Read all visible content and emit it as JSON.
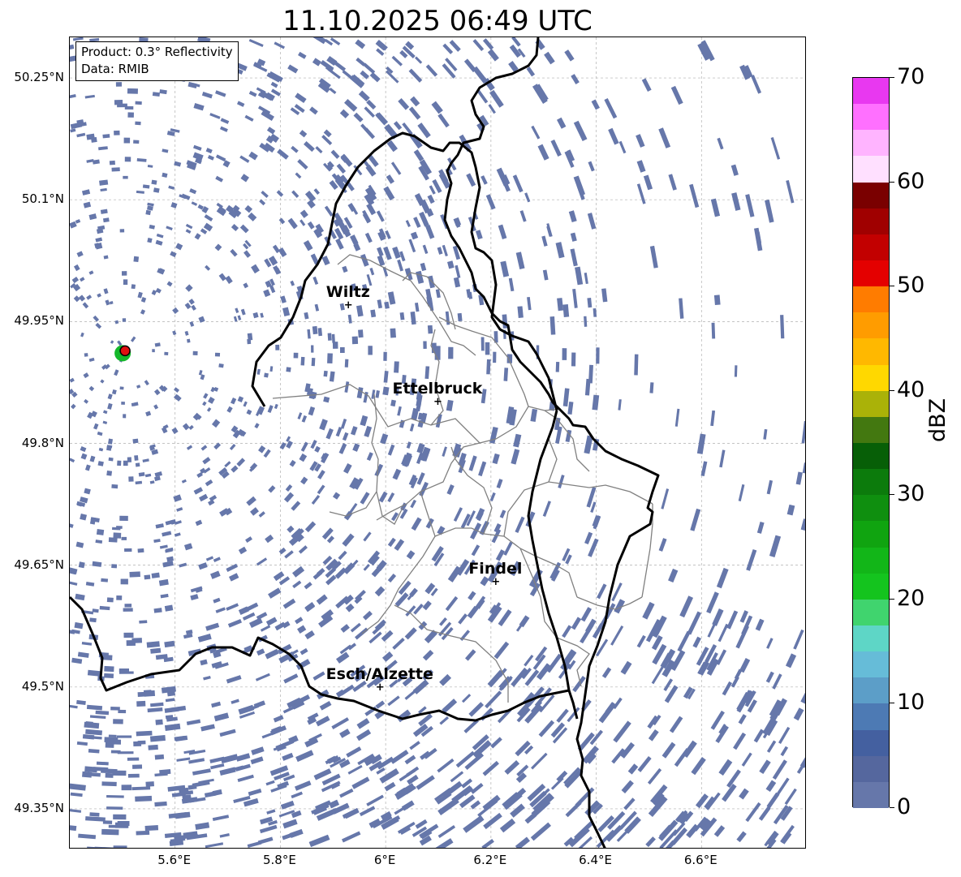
{
  "title": "11.10.2025 06:49 UTC",
  "info": {
    "product": "Product: 0.3° Reflectivity",
    "data": "Data: RMIB"
  },
  "map": {
    "lon_min": 5.4,
    "lon_max": 6.8,
    "lat_min": 49.3,
    "lat_max": 50.3,
    "lat_ticks": [
      {
        "value": 50.25,
        "label": "50.25°N"
      },
      {
        "value": 50.1,
        "label": "50.1°N"
      },
      {
        "value": 49.95,
        "label": "49.95°N"
      },
      {
        "value": 49.8,
        "label": "49.8°N"
      },
      {
        "value": 49.65,
        "label": "49.65°N"
      },
      {
        "value": 49.5,
        "label": "49.5°N"
      },
      {
        "value": 49.35,
        "label": "49.35°N"
      }
    ],
    "lon_ticks": [
      {
        "value": 5.6,
        "label": "5.6°E"
      },
      {
        "value": 5.8,
        "label": "5.8°E"
      },
      {
        "value": 6.0,
        "label": "6°E"
      },
      {
        "value": 6.2,
        "label": "6.2°E"
      },
      {
        "value": 6.4,
        "label": "6.4°E"
      },
      {
        "value": 6.6,
        "label": "6.6°E"
      }
    ],
    "cities": [
      {
        "name": "Wiltz",
        "lon": 5.93,
        "lat": 49.968
      },
      {
        "name": "Ettelbruck",
        "lon": 6.1,
        "lat": 49.849
      },
      {
        "name": "Findel",
        "lon": 6.21,
        "lat": 49.628
      },
      {
        "name": "Esch/Alzette",
        "lon": 5.99,
        "lat": 49.498
      }
    ],
    "radar_site": {
      "lon": 5.505,
      "lat": 49.914
    },
    "border_color": "#000000",
    "canton_color": "#808080",
    "echo_color": "#6677aa"
  },
  "colorbar": {
    "unit": "dBZ",
    "min": 0,
    "max": 70,
    "ticks": [
      0,
      10,
      20,
      30,
      40,
      50,
      60,
      70
    ],
    "colors": [
      "#6677aa",
      "#55679e",
      "#4460a0",
      "#4d7ab4",
      "#5c9ec8",
      "#66bcd8",
      "#5ed6c6",
      "#40d46e",
      "#14c41e",
      "#12b618",
      "#10a410",
      "#0f8f0f",
      "#0c7b0c",
      "#075f07",
      "#437810",
      "#aab208",
      "#ffd800",
      "#ffb800",
      "#ff9c00",
      "#ff7c00",
      "#e40000",
      "#c20000",
      "#a00000",
      "#7a0000",
      "#ffe0ff",
      "#ffb4ff",
      "#ff70ff",
      "#e838f0"
    ]
  }
}
